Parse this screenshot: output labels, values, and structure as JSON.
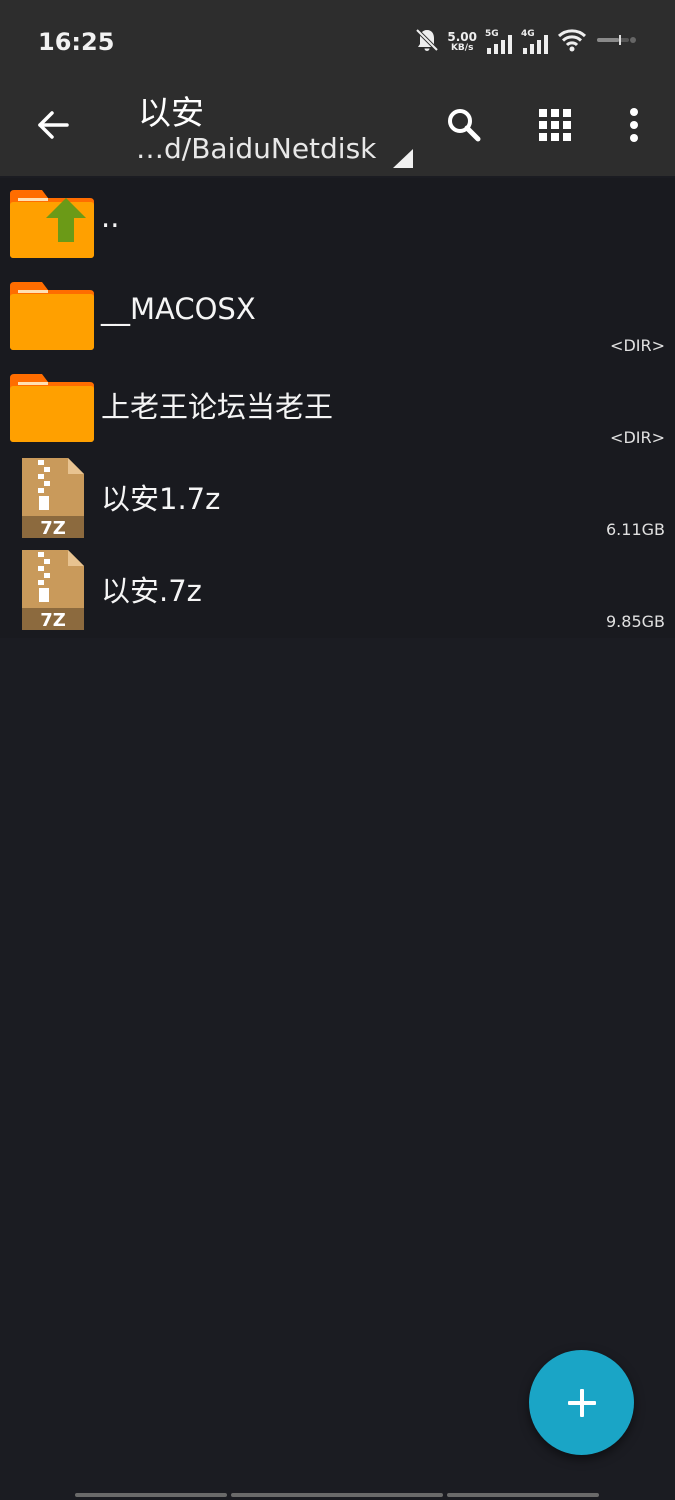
{
  "status_bar": {
    "time": "16:25",
    "net_speed_value": "5.00",
    "net_speed_unit": "KB/s",
    "sig1_tag": "5G",
    "sig2_tag": "4G",
    "icons": [
      "mute-bell-icon",
      "signal-5g-icon",
      "signal-4g-icon",
      "wifi-icon",
      "battery-icon"
    ]
  },
  "appbar": {
    "title": "以安",
    "path": "…d/BaiduNetdisk",
    "icons": [
      "back-arrow-icon",
      "search-icon",
      "grid-view-icon",
      "more-vert-icon"
    ]
  },
  "files": [
    {
      "name": "..",
      "meta": "",
      "type": "parent-folder"
    },
    {
      "name": "__MACOSX",
      "meta": "<DIR>",
      "type": "folder"
    },
    {
      "name": "上老王论坛当老王",
      "meta": "<DIR>",
      "type": "folder"
    },
    {
      "name": "以安1.7z",
      "meta": "6.11GB",
      "type": "archive-7z"
    },
    {
      "name": "以安.7z",
      "meta": "9.85GB",
      "type": "archive-7z"
    }
  ],
  "archive_badge": "7Z",
  "fab": {
    "icon": "plus-icon"
  },
  "colors": {
    "folder": "#ffa000",
    "folder_tab": "#ff6d00",
    "up_arrow": "#6b9a17",
    "archive": "#c99a5b",
    "fab": "#1aa5c6"
  }
}
